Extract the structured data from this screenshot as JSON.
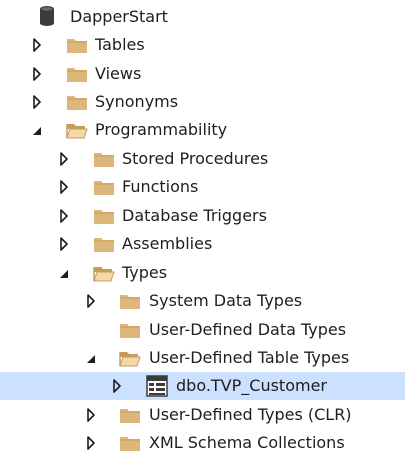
{
  "tree": {
    "nodes": [
      {
        "id": "dapperstart",
        "label": "DapperStart",
        "icon": "database-icon",
        "expander": "none"
      },
      {
        "id": "tables",
        "label": "Tables",
        "icon": "folder-icon",
        "expander": "collapsed"
      },
      {
        "id": "views",
        "label": "Views",
        "icon": "folder-icon",
        "expander": "collapsed"
      },
      {
        "id": "synonyms",
        "label": "Synonyms",
        "icon": "folder-icon",
        "expander": "collapsed"
      },
      {
        "id": "programmability",
        "label": "Programmability",
        "icon": "folder-open-icon",
        "expander": "expanded"
      },
      {
        "id": "stored-procedures",
        "label": "Stored Procedures",
        "icon": "folder-icon",
        "expander": "collapsed"
      },
      {
        "id": "functions",
        "label": "Functions",
        "icon": "folder-icon",
        "expander": "collapsed"
      },
      {
        "id": "database-triggers",
        "label": "Database Triggers",
        "icon": "folder-icon",
        "expander": "collapsed"
      },
      {
        "id": "assemblies",
        "label": "Assemblies",
        "icon": "folder-icon",
        "expander": "collapsed"
      },
      {
        "id": "types",
        "label": "Types",
        "icon": "folder-open-icon",
        "expander": "expanded"
      },
      {
        "id": "system-data-types",
        "label": "System Data Types",
        "icon": "folder-icon",
        "expander": "collapsed"
      },
      {
        "id": "user-defined-data-types",
        "label": "User-Defined Data Types",
        "icon": "folder-icon",
        "expander": "none"
      },
      {
        "id": "user-defined-table-types",
        "label": "User-Defined Table Types",
        "icon": "folder-open-icon",
        "expander": "expanded"
      },
      {
        "id": "tvp-customer",
        "label": "dbo.TVP_Customer",
        "icon": "table-type-icon",
        "expander": "collapsed",
        "selected": true
      },
      {
        "id": "user-defined-types-clr",
        "label": "User-Defined Types (CLR)",
        "icon": "folder-icon",
        "expander": "collapsed"
      },
      {
        "id": "xml-schema-collections",
        "label": "XML Schema Collections",
        "icon": "folder-icon",
        "expander": "collapsed"
      }
    ]
  },
  "colors": {
    "folder": "#dcb67a",
    "folder_dark": "#c69c5c",
    "selection": "#cce0ff",
    "text": "#1e1e1e",
    "arrow": "#1e1e1e"
  }
}
